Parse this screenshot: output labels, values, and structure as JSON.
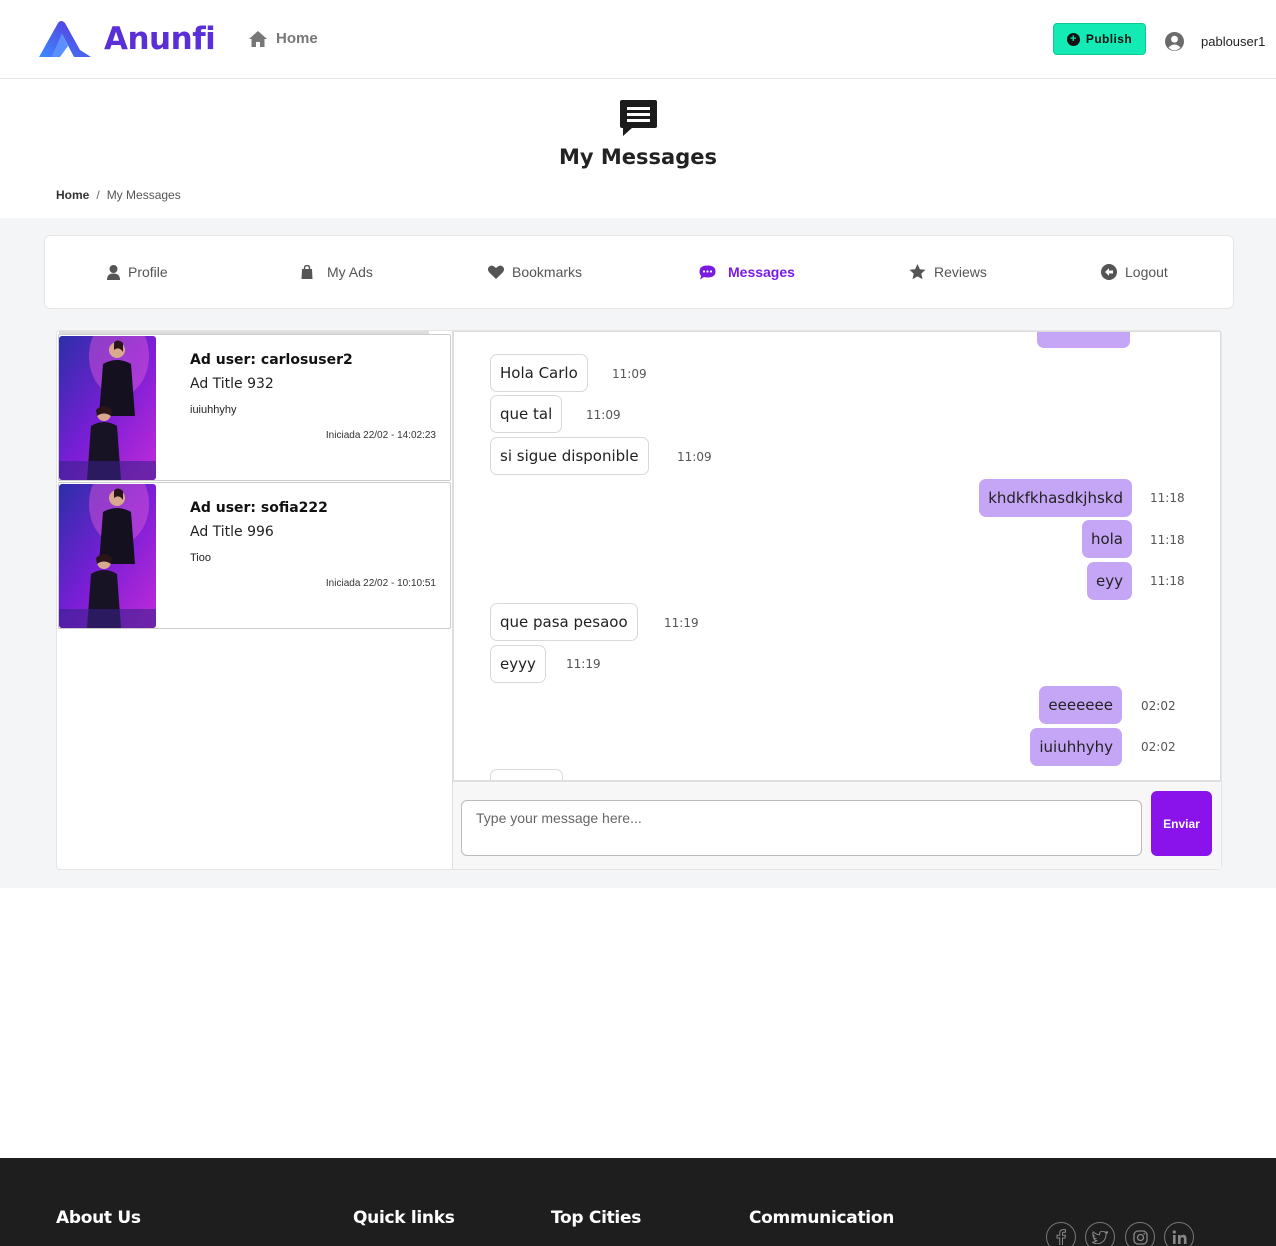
{
  "header": {
    "logo_text": "Anunfi",
    "nav_home": "Home",
    "publish_label": "Publish",
    "username": "pablouser1"
  },
  "page": {
    "title": "My Messages",
    "breadcrumb_home": "Home",
    "breadcrumb_sep": "/",
    "breadcrumb_current": "My Messages"
  },
  "tabs": [
    {
      "label": "Profile",
      "icon": "user-icon"
    },
    {
      "label": "My Ads",
      "icon": "bag-icon"
    },
    {
      "label": "Bookmarks",
      "icon": "heart-icon"
    },
    {
      "label": "Messages",
      "icon": "chat-icon",
      "active": true
    },
    {
      "label": "Reviews",
      "icon": "star-icon"
    },
    {
      "label": "Logout",
      "icon": "logout-icon"
    }
  ],
  "conversations": [
    {
      "user": "Ad user: carlosuser2",
      "ad_title": "Ad Title 932",
      "last_message": "iuiuhhyhy",
      "started": "Iniciada 22/02 - 14:02:23"
    },
    {
      "user": "Ad user: sofia222",
      "ad_title": "Ad Title 996",
      "last_message": "Tioo",
      "started": "Iniciada 22/02 - 10:10:51"
    }
  ],
  "messages": [
    {
      "text": "Hola Carlo",
      "time": "11:09",
      "direction": "in"
    },
    {
      "text": "que tal",
      "time": "11:09",
      "direction": "in"
    },
    {
      "text": "si sigue disponible",
      "time": "11:09",
      "direction": "in"
    },
    {
      "text": "khdkfkhasdkjhskd",
      "time": "11:18",
      "direction": "out"
    },
    {
      "text": "hola",
      "time": "11:18",
      "direction": "out"
    },
    {
      "text": "eyy",
      "time": "11:18",
      "direction": "out"
    },
    {
      "text": "que pasa pesaoo",
      "time": "11:19",
      "direction": "in"
    },
    {
      "text": "eyyy",
      "time": "11:19",
      "direction": "in"
    },
    {
      "text": "eeeeeee",
      "time": "02:02",
      "direction": "out"
    },
    {
      "text": "iuiuhhyhy",
      "time": "02:02",
      "direction": "out"
    }
  ],
  "composer": {
    "placeholder": "Type your message here...",
    "send_label": "Enviar"
  },
  "footer": {
    "headings": [
      "About Us",
      "Quick links",
      "Top Cities",
      "Communication"
    ],
    "social": [
      "facebook-icon",
      "twitter-icon",
      "instagram-icon",
      "linkedin-icon"
    ]
  },
  "colors": {
    "brand": "#5b2fd8",
    "accent": "#8a12ea",
    "publish": "#14eab3",
    "bubble_out": "#c5a6f6"
  }
}
